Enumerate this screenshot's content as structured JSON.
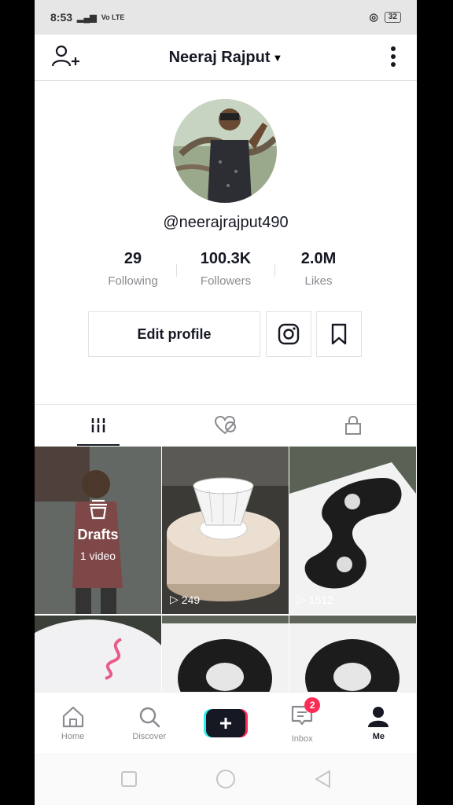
{
  "status_bar": {
    "time": "8:53",
    "network": "Vo LTE",
    "battery": "32"
  },
  "header": {
    "username": "Neeraj Rajput"
  },
  "profile": {
    "handle": "@neerajrajput490",
    "stats": [
      {
        "value": "29",
        "label": "Following"
      },
      {
        "value": "100.3K",
        "label": "Followers"
      },
      {
        "value": "2.0M",
        "label": "Likes"
      }
    ],
    "edit_label": "Edit profile"
  },
  "grid": {
    "drafts": {
      "title": "Drafts",
      "count": "1 video"
    },
    "videos": [
      {
        "views": "249"
      },
      {
        "views": "1512"
      }
    ]
  },
  "bottom_nav": {
    "items": [
      {
        "label": "Home",
        "icon": "home-icon"
      },
      {
        "label": "Discover",
        "icon": "search-icon"
      },
      {
        "label": "",
        "icon": "plus-icon"
      },
      {
        "label": "Inbox",
        "icon": "inbox-icon",
        "badge": "2"
      },
      {
        "label": "Me",
        "icon": "person-icon"
      }
    ]
  },
  "colors": {
    "accent_red": "#fe2c55",
    "accent_cyan": "#25f4ee",
    "text": "#161823",
    "muted": "#8a8b91"
  }
}
